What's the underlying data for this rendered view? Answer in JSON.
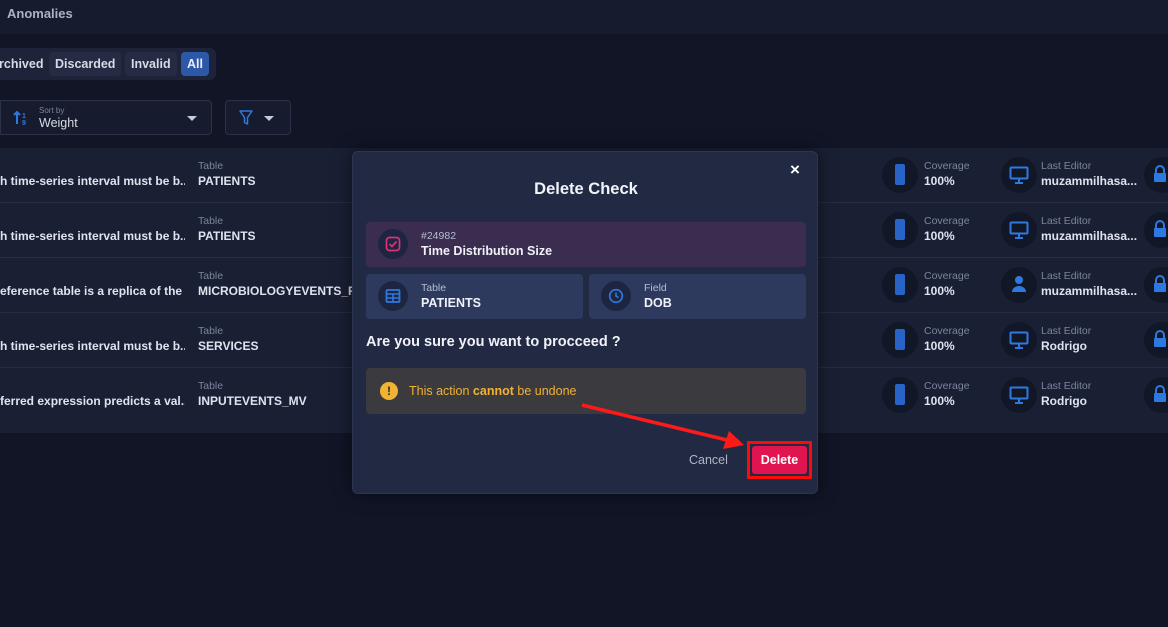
{
  "header": {
    "title": "Anomalies"
  },
  "status_tabs": [
    "rchived",
    "Discarded",
    "Invalid",
    "All"
  ],
  "sort": {
    "caption": "Sort by",
    "value": "Weight"
  },
  "rows": [
    {
      "description": "h time-series interval must be b...",
      "table_caption": "Table",
      "table": "PATIENTS",
      "coverage_caption": "Coverage",
      "coverage": "100%",
      "editor_caption": "Last Editor",
      "editor": "muzammilhasa..."
    },
    {
      "description": "h time-series interval must be b...",
      "table_caption": "Table",
      "table": "PATIENTS",
      "coverage_caption": "Coverage",
      "coverage": "100%",
      "editor_caption": "Last Editor",
      "editor": "muzammilhasa..."
    },
    {
      "description": "eference table is a replica of the ...",
      "table_caption": "Table",
      "table": "MICROBIOLOGYEVENTS_REF",
      "coverage_caption": "Coverage",
      "coverage": "100%",
      "editor_caption": "Last Editor",
      "editor": "muzammilhasa..."
    },
    {
      "description": "h time-series interval must be b...",
      "table_caption": "Table",
      "table": "SERVICES",
      "coverage_caption": "Coverage",
      "coverage": "100%",
      "editor_caption": "Last Editor",
      "editor": "Rodrigo"
    },
    {
      "description": "ferred expression predicts a val...",
      "table_caption": "Table",
      "table": "INPUTEVENTS_MV",
      "coverage_caption": "Coverage",
      "coverage": "100%",
      "editor_caption": "Last Editor",
      "editor": "Rodrigo"
    }
  ],
  "modal": {
    "close_label": "×",
    "title": "Delete Check",
    "check": {
      "id": "#24982",
      "name": "Time Distribution Size"
    },
    "table_card": {
      "caption": "Table",
      "value": "PATIENTS"
    },
    "field_card": {
      "caption": "Field",
      "value": "DOB"
    },
    "question": "Are you sure you want to procceed ?",
    "warning": {
      "icon": "!",
      "prefix": "This action ",
      "emphasis": "cannot",
      "suffix": " be undone"
    },
    "cancel_label": "Cancel",
    "delete_label": "Delete"
  },
  "icons": {
    "sort": "sort-icon",
    "filter": "filter-icon",
    "coverage": "coverage-bar-icon",
    "editor_monitor": "monitor-icon",
    "editor_user": "user-icon",
    "lock": "lock-icon",
    "check": "check-square-icon",
    "table": "table-grid-icon",
    "field": "clock-icon",
    "warning": "warning-icon"
  },
  "colors": {
    "accent": "#2d58a8",
    "delete": "#e0144f",
    "highlight": "#ff0a0a",
    "warning": "#f2b233"
  }
}
